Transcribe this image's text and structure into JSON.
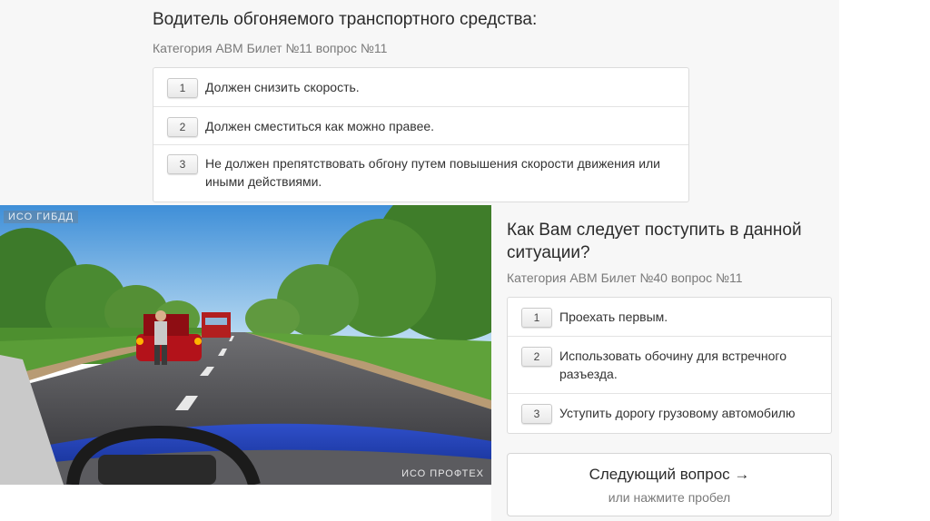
{
  "question1": {
    "title": "Водитель обгоняемого транспортного средства:",
    "category": "Категория ABM  Билет №11  вопрос №11",
    "answers": [
      {
        "num": "1",
        "text": "Должен снизить скорость."
      },
      {
        "num": "2",
        "text": "Должен сместиться как можно правее."
      },
      {
        "num": "3",
        "text": "Не должен препятствовать обгону путем повышения скорости движения или иными действиями."
      }
    ]
  },
  "question2": {
    "title": "Как Вам следует поступить в данной ситуации?",
    "category": "Категория ABM  Билет №40  вопрос №11",
    "answers": [
      {
        "num": "1",
        "text": "Проехать первым."
      },
      {
        "num": "2",
        "text": "Использовать обочину для встречного разъезда."
      },
      {
        "num": "3",
        "text": "Уступить дорогу грузовому автомобилю"
      }
    ]
  },
  "image": {
    "watermark_top": "ИСО  ГИБДД",
    "watermark_bottom": "ИСО ПРОФТЕХ"
  },
  "next_button": {
    "label": "Следующий вопрос →",
    "sub": "или нажмите пробел"
  }
}
